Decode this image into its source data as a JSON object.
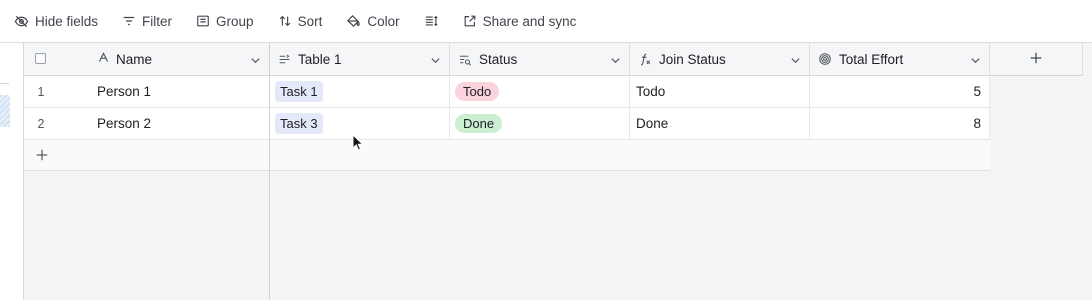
{
  "toolbar": {
    "hide_fields": "Hide fields",
    "filter": "Filter",
    "group": "Group",
    "sort": "Sort",
    "color": "Color",
    "share": "Share and sync"
  },
  "columns": {
    "name": "Name",
    "table1": "Table 1",
    "status": "Status",
    "join_status": "Join Status",
    "total_effort": "Total Effort"
  },
  "rows": [
    {
      "num": "1",
      "name": "Person 1",
      "table1": "Task 1",
      "status": "Todo",
      "status_color": "#fbd3dc",
      "join_status": "Todo",
      "total_effort": "5"
    },
    {
      "num": "2",
      "name": "Person 2",
      "table1": "Task 3",
      "status": "Done",
      "status_color": "#cdefd1",
      "join_status": "Done",
      "total_effort": "8"
    }
  ],
  "icons": {
    "hide_fields": "eye-slash-icon",
    "filter": "filter-icon",
    "group": "group-icon",
    "sort": "sort-icon",
    "color": "paint-bucket-icon",
    "row_height": "row-height-icon",
    "share": "share-icon",
    "name_field": "text-field-icon",
    "link_field": "link-field-icon",
    "lookup_field": "lookup-field-icon",
    "formula_field": "formula-field-icon",
    "rollup_field": "rollup-field-icon",
    "add": "plus-icon",
    "chevron": "chevron-down-icon"
  }
}
